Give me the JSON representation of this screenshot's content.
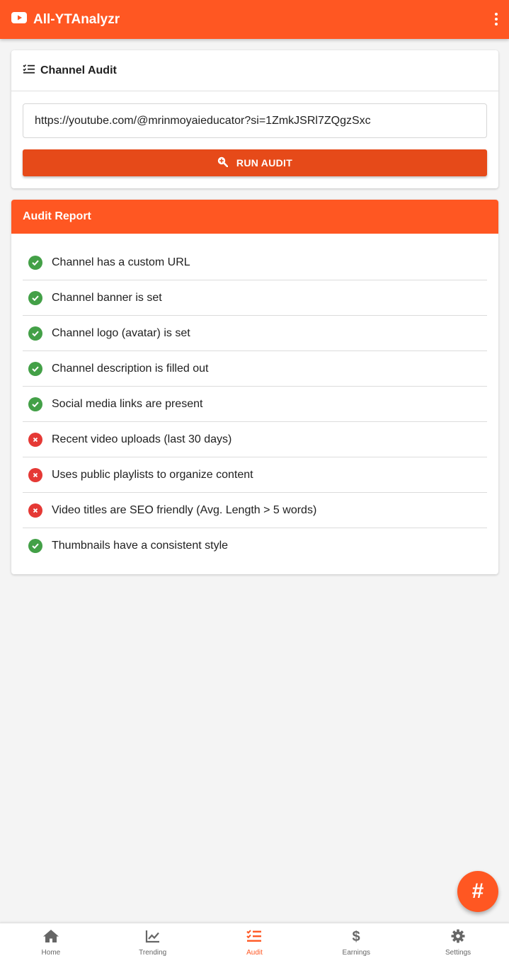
{
  "app": {
    "title": "All-YTAnalyzr",
    "icon": "youtube-icon",
    "menu_icon": "more-vert-icon",
    "accent": "#ff5722"
  },
  "audit_card": {
    "title": "Channel Audit",
    "icon": "checklist-icon",
    "url_value": "https://youtube.com/@mrinmoyaieducator?si=1ZmkJSRl7ZQgzSxc",
    "run_button_label": "RUN AUDIT",
    "run_button_icon": "search-plus-icon"
  },
  "report": {
    "title": "Audit Report",
    "items": [
      {
        "label": "Channel has a custom URL",
        "status": "pass"
      },
      {
        "label": "Channel banner is set",
        "status": "pass"
      },
      {
        "label": "Channel logo (avatar) is set",
        "status": "pass"
      },
      {
        "label": "Channel description is filled out",
        "status": "pass"
      },
      {
        "label": "Social media links are present",
        "status": "pass"
      },
      {
        "label": "Recent video uploads (last 30 days)",
        "status": "fail"
      },
      {
        "label": "Uses public playlists to organize content",
        "status": "fail"
      },
      {
        "label": "Video titles are SEO friendly (Avg. Length > 5 words)",
        "status": "fail"
      },
      {
        "label": "Thumbnails have a consistent style",
        "status": "pass"
      }
    ],
    "colors": {
      "pass": "#43a047",
      "fail": "#e53935"
    }
  },
  "fab": {
    "label": "#"
  },
  "bottom_nav": [
    {
      "label": "Home",
      "icon": "home-icon"
    },
    {
      "label": "Trending",
      "icon": "chart-line-icon"
    },
    {
      "label": "Audit",
      "icon": "checklist-icon",
      "active": true
    },
    {
      "label": "Earnings",
      "icon": "dollar-icon"
    },
    {
      "label": "Settings",
      "icon": "gear-icon"
    }
  ]
}
